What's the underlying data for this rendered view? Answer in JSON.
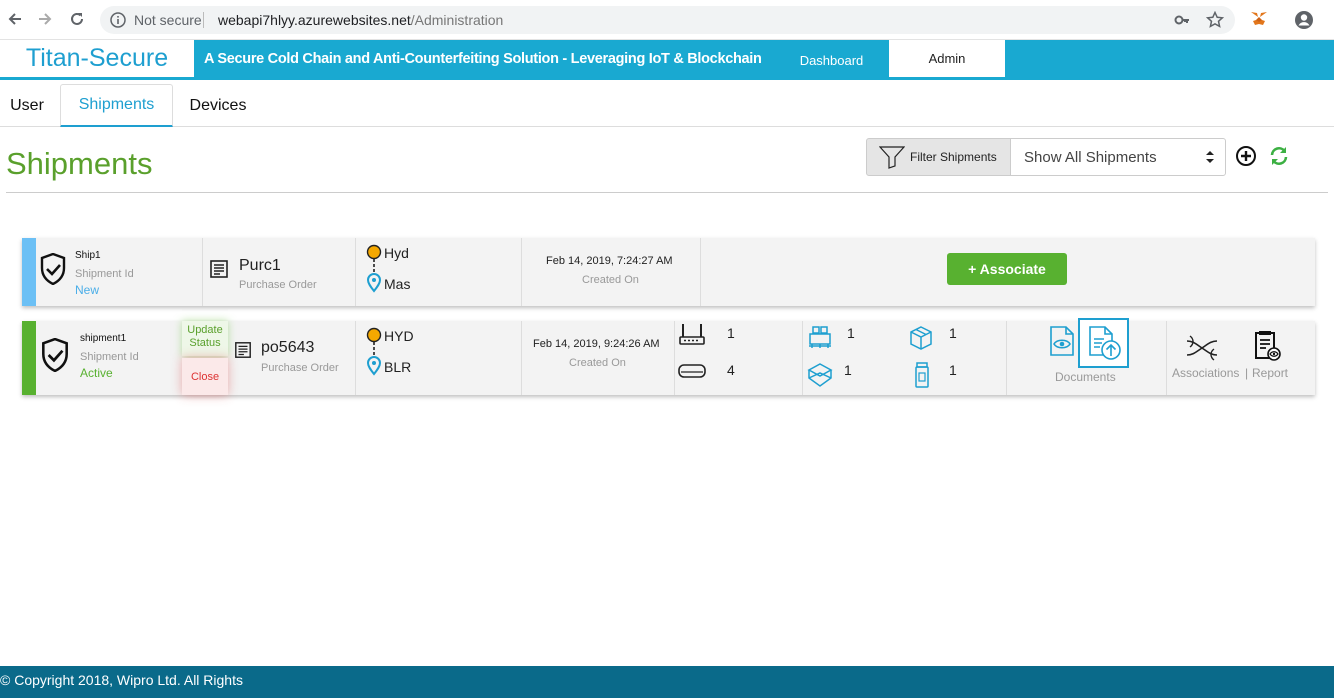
{
  "browser": {
    "security_label": "Not secure",
    "url_host": "webapi7hlyy.azurewebsites.net",
    "url_path": "/Administration"
  },
  "header": {
    "brand": "Titan-Secure",
    "tagline": "A Secure Cold Chain and Anti-Counterfeiting Solution - Leveraging IoT & Blockchain",
    "nav": [
      "Dashboard",
      "Admin"
    ],
    "active_nav": "Admin",
    "accent": "#19a9d1"
  },
  "tabs": [
    "User",
    "Shipments",
    "Devices"
  ],
  "active_tab": "Shipments",
  "page": {
    "title": "Shipments",
    "filter_button": "Filter Shipments",
    "filter_value": "Show All Shipments"
  },
  "shipments": [
    {
      "name": "Ship1",
      "id_label": "Shipment Id",
      "status": "New",
      "status_color": "#4aaee8",
      "po": "Purc1",
      "po_label": "Purchase Order",
      "origin": "Hyd",
      "destination": "Mas",
      "created": "Feb 14, 2019, 7:24:27 AM",
      "created_label": "Created On",
      "associate_button": "+ Associate"
    },
    {
      "name": "shipment1",
      "id_label": "Shipment Id",
      "status": "Active",
      "status_color": "#58b130",
      "update_button": "Update Status",
      "close_button": "Close",
      "po": "po5643",
      "po_label": "Purchase Order",
      "origin": "HYD",
      "destination": "BLR",
      "created": "Feb 14, 2019, 9:24:26 AM",
      "created_label": "Created On",
      "devices": [
        {
          "icon": "router-icon",
          "count": "1"
        },
        {
          "icon": "sensor-strip-icon",
          "count": "4"
        }
      ],
      "packages": [
        {
          "icon": "pallet-icon",
          "count": "1"
        },
        {
          "icon": "box-icon",
          "count": "1"
        },
        {
          "icon": "tray-icon",
          "count": "1"
        },
        {
          "icon": "bottle-icon",
          "count": "1"
        }
      ],
      "documents_label": "Documents",
      "associations_label": "Associations",
      "report_label": "Report",
      "links_separator": "|"
    }
  ],
  "footer": {
    "copyright": "© Copyright 2018, Wipro Ltd. All Rights"
  }
}
